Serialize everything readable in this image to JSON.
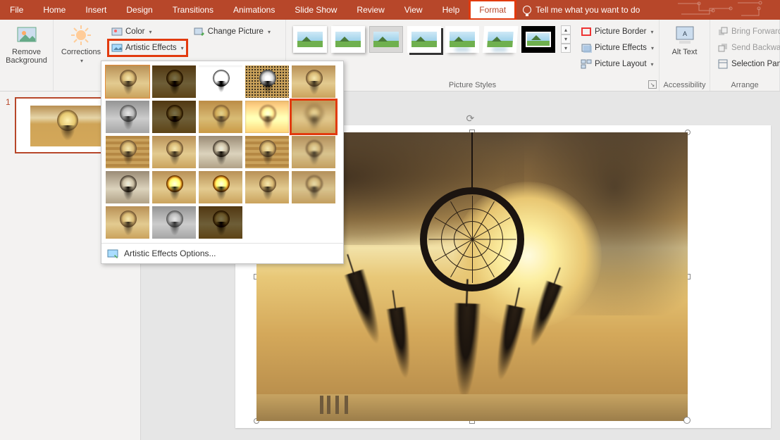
{
  "tabs": {
    "file": "File",
    "home": "Home",
    "insert": "Insert",
    "design": "Design",
    "transitions": "Transitions",
    "animations": "Animations",
    "slideshow": "Slide Show",
    "review": "Review",
    "view": "View",
    "help": "Help",
    "format": "Format",
    "tellme": "Tell me what you want to do"
  },
  "ribbon": {
    "remove_bg": "Remove Background",
    "corrections": "Corrections",
    "color": "Color",
    "artistic": "Artistic Effects",
    "change_pic": "Change Picture",
    "adjust_label": "",
    "styles_label": "Picture Styles",
    "border": "Picture Border",
    "effects": "Picture Effects",
    "layout": "Picture Layout",
    "alt_text": "Alt Text",
    "access_label": "Accessibility",
    "bring_fwd": "Bring Forward",
    "send_bwd": "Send Backward",
    "sel_pane": "Selection Pane",
    "arrange_label": "Arrange"
  },
  "dropdown": {
    "options": "Artistic Effects Options..."
  },
  "slides": {
    "num1": "1"
  }
}
